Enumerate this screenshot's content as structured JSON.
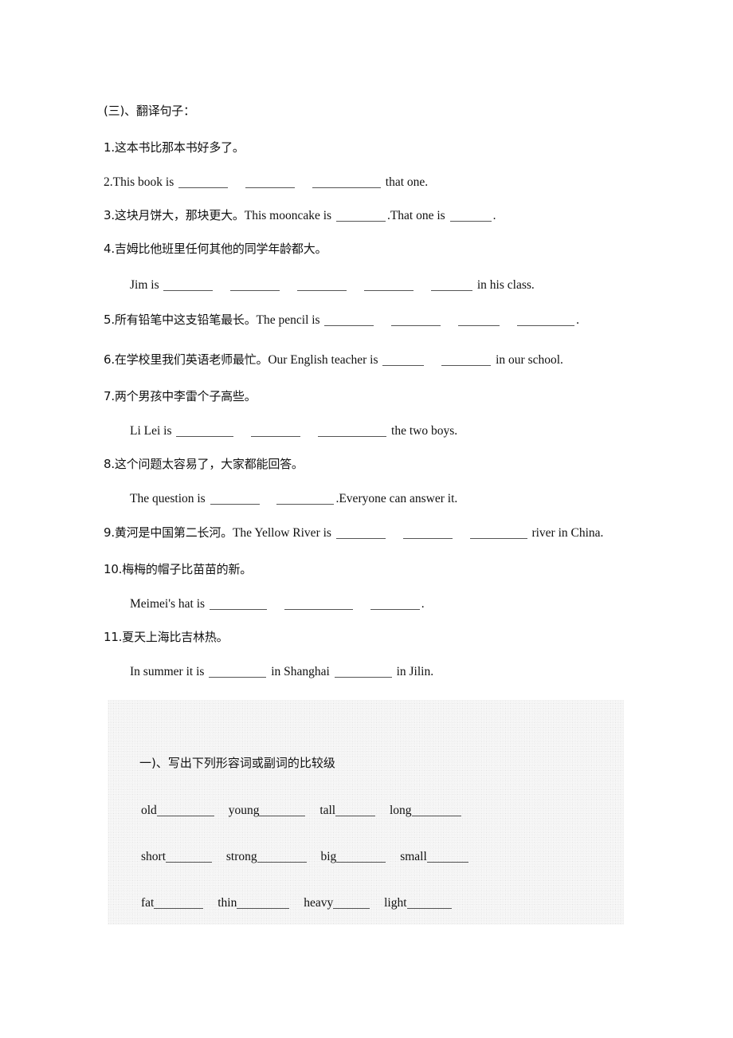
{
  "document": {
    "section_heading": "(三)、翻译句子：",
    "questions": [
      {
        "id": "q1",
        "number": "1.",
        "chinese": "这本书比那本书好多了。",
        "type": "chinese-prompt"
      },
      {
        "id": "q2",
        "number": "2.",
        "english_before": "This book is",
        "blanks": [
          "",
          "",
          ""
        ],
        "english_after": "that one.",
        "type": "english-answer"
      },
      {
        "id": "q3",
        "number": "3.",
        "chinese": "这块月饼大，那块更大。",
        "english_before": "This mooncake is",
        "blanks": [
          "",
          ""
        ],
        "english_middle": ".That one is",
        "english_after": ".",
        "type": "mixed"
      },
      {
        "id": "q4",
        "number": "4.",
        "chinese": "吉姆比他班里任何其他的同学年龄都大。",
        "type": "chinese-prompt"
      },
      {
        "id": "q4a",
        "english_before": "Jim is",
        "blanks": [
          "",
          "",
          "",
          "",
          ""
        ],
        "english_after": "in his class.",
        "type": "english-answer-indent"
      },
      {
        "id": "q5",
        "number": "5.",
        "chinese": "所有铅笔中这支铅笔最长。",
        "english_before": "The pencil is",
        "blanks": [
          "",
          "",
          "",
          ""
        ],
        "english_after": ".",
        "type": "mixed"
      },
      {
        "id": "q6",
        "number": "6.",
        "chinese": "在学校里我们英语老师最忙。",
        "english_before": "Our English teacher is",
        "blanks": [
          "",
          ""
        ],
        "english_after": "in our school.",
        "type": "mixed"
      },
      {
        "id": "q7",
        "number": "7.",
        "chinese": "两个男孩中李雷个子高些。",
        "type": "chinese-prompt"
      },
      {
        "id": "q7a",
        "english_before": "Li Lei is",
        "blanks": [
          "",
          "",
          ""
        ],
        "english_after": "the two boys.",
        "type": "english-answer-indent"
      },
      {
        "id": "q8",
        "number": "8.",
        "chinese": "这个问题太容易了，大家都能回答。",
        "type": "chinese-prompt"
      },
      {
        "id": "q8a",
        "english_before": "The question is",
        "blanks": [
          "",
          ""
        ],
        "english_after": ".Everyone can answer it.",
        "type": "english-answer-indent"
      },
      {
        "id": "q9",
        "number": "9.",
        "chinese": "黄河是中国第二长河。",
        "english_before": "The Yellow River is",
        "blanks": [
          "",
          "",
          ""
        ],
        "english_after": "river in China.",
        "type": "mixed"
      },
      {
        "id": "q10",
        "number": "10.",
        "chinese": "梅梅的帽子比苗苗的新。",
        "type": "chinese-prompt"
      },
      {
        "id": "q10a",
        "english_before": "Meimei's hat is",
        "blanks": [
          "",
          "",
          ""
        ],
        "english_after": ".",
        "type": "english-answer-indent"
      },
      {
        "id": "q11",
        "number": "11.",
        "chinese": "夏天上海比吉林热。",
        "type": "chinese-prompt"
      },
      {
        "id": "q11a",
        "english_before": "In summer it is",
        "blanks": [
          "",
          ""
        ],
        "english_after": "in Jilin.",
        "english_middle": "in Shanghai",
        "type": "english-answer-indent"
      }
    ],
    "lines": {
      "l1_number": "1.",
      "l1_chinese": "这本书比那本书好多了。",
      "l2_number": "2.",
      "l2_before": "This book is",
      "l2_after": "that one.",
      "l3_number": "3.",
      "l3_chinese": "这块月饼大，那块更大。",
      "l3_en1": "This mooncake is",
      "l3_en2": ".That one is",
      "l3_en3": ".",
      "l4_number": "4.",
      "l4_chinese": "吉姆比他班里任何其他的同学年龄都大。",
      "l4a_before": "Jim is",
      "l4a_after": "in his class.",
      "l5_number": "5.",
      "l5_chinese": "所有铅笔中这支铅笔最长。",
      "l5_en1": "The pencil is",
      "l5_en2": ".",
      "l6_number": "6.",
      "l6_chinese": "在学校里我们英语老师最忙。",
      "l6_en1": "Our English teacher is",
      "l6_en2": "in our school.",
      "l7_number": "7.",
      "l7_chinese": "两个男孩中李雷个子高些。",
      "l7a_before": "Li Lei is",
      "l7a_after": "the two boys.",
      "l8_number": "8.",
      "l8_chinese": "这个问题太容易了，大家都能回答。",
      "l8a_before": "The question is",
      "l8a_after": ".Everyone can answer it.",
      "l9_number": "9.",
      "l9_chinese": "黄河是中国第二长河。",
      "l9_en1": "The Yellow River is",
      "l9_en2": "river in China.",
      "l10_number": "10.",
      "l10_chinese": "梅梅的帽子比苗苗的新。",
      "l10a_before": "Meimei's hat is",
      "l10a_after": ".",
      "l11_number": "11.",
      "l11_chinese": "夏天上海比吉林热。",
      "l11a_before": "In summer it is",
      "l11a_middle": "in Shanghai",
      "l11a_after": "in Jilin."
    }
  },
  "exercise_box": {
    "heading": "一)、写出下列形容词或副词的比较级",
    "background_color": "#ececec",
    "rows": [
      {
        "words": [
          "old",
          "young",
          "tall",
          "long"
        ]
      },
      {
        "words": [
          "short",
          "strong",
          "big",
          "small"
        ]
      },
      {
        "words": [
          "fat",
          "thin",
          "heavy",
          "light"
        ]
      }
    ],
    "words_flat": {
      "r1c1": "old",
      "r1c2": "young",
      "r1c3": "tall",
      "r1c4": "long",
      "r2c1": "short",
      "r2c2": "strong",
      "r2c3": "big",
      "r2c4": "small",
      "r3c1": "fat",
      "r3c2": "thin",
      "r3c3": "heavy",
      "r3c4": "light"
    }
  }
}
